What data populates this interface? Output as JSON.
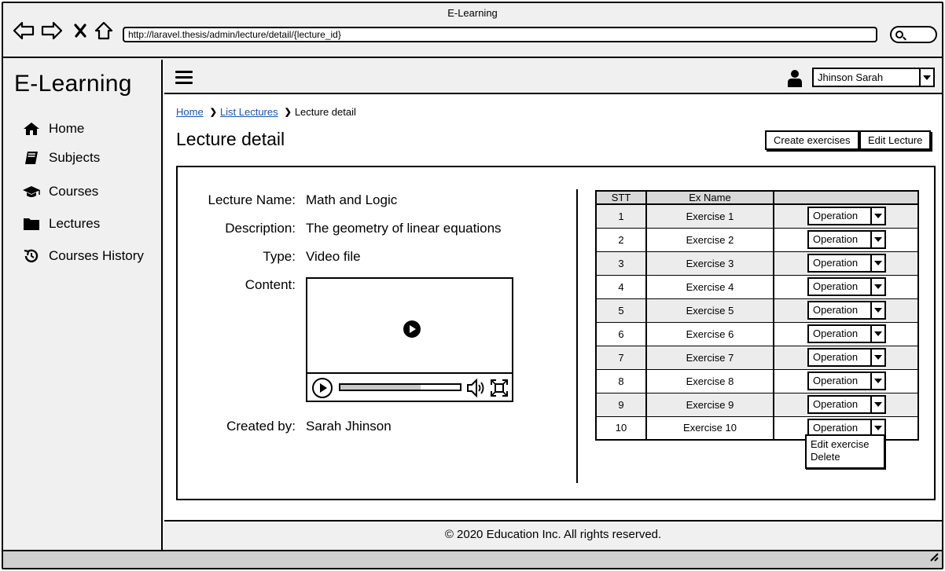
{
  "window": {
    "title": "E-Learning"
  },
  "browser": {
    "url": "http://laravel.thesis/admin/lecture/detail/{lecture_id}"
  },
  "sidebar": {
    "brand": "E-Learning",
    "items": [
      {
        "label": "Home",
        "icon": "home-icon"
      },
      {
        "label": "Subjects",
        "icon": "book-icon"
      },
      {
        "label": "Courses",
        "icon": "graduation-cap-icon"
      },
      {
        "label": "Lectures",
        "icon": "folder-icon"
      },
      {
        "label": "Courses History",
        "icon": "history-icon"
      }
    ]
  },
  "header": {
    "user_name": "Jhinson Sarah"
  },
  "breadcrumb": {
    "home": "Home",
    "list": "List Lectures",
    "current": "Lecture detail"
  },
  "page": {
    "title": "Lecture detail",
    "create_exercises_label": "Create exercises",
    "edit_lecture_label": "Edit Lecture"
  },
  "lecture": {
    "name_label": "Lecture Name:",
    "name": "Math and Logic",
    "description_label": "Description:",
    "description": "The geometry of linear equations",
    "type_label": "Type:",
    "type": "Video file",
    "content_label": "Content:",
    "created_by_label": "Created by:",
    "created_by": "Sarah Jhinson",
    "video_progress": 0.67
  },
  "table": {
    "headers": [
      "STT",
      "Ex Name",
      ""
    ],
    "operation_label": "Operation",
    "rows": [
      {
        "stt": "1",
        "name": "Exercise 1"
      },
      {
        "stt": "2",
        "name": "Exercise 2"
      },
      {
        "stt": "3",
        "name": "Exercise 3"
      },
      {
        "stt": "4",
        "name": "Exercise 4"
      },
      {
        "stt": "5",
        "name": "Exercise 5"
      },
      {
        "stt": "6",
        "name": "Exercise 6"
      },
      {
        "stt": "7",
        "name": "Exercise 7"
      },
      {
        "stt": "8",
        "name": "Exercise 8"
      },
      {
        "stt": "9",
        "name": "Exercise 9"
      },
      {
        "stt": "10",
        "name": "Exercise 10"
      }
    ]
  },
  "operation_menu": {
    "edit": "Edit exercise",
    "delete": "Delete"
  },
  "footer": {
    "text": "© 2020 Education Inc. All rights reserved."
  }
}
